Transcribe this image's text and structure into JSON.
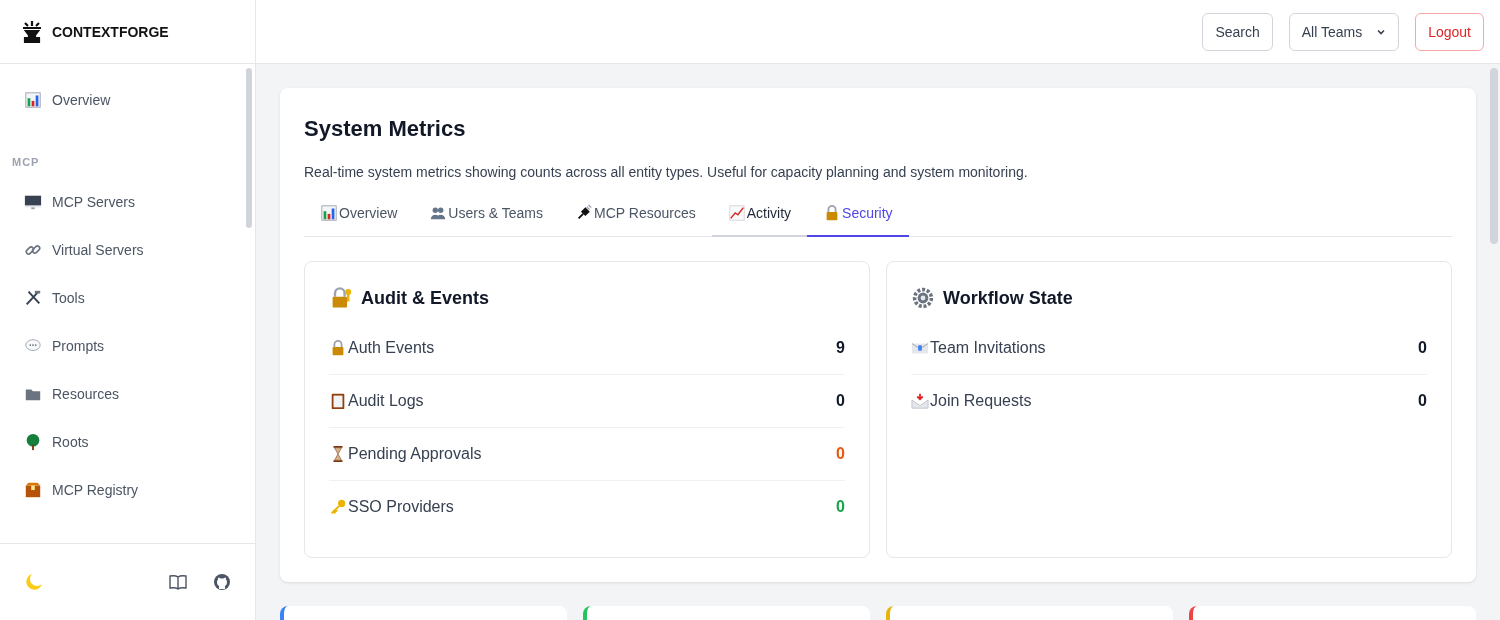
{
  "brand": {
    "name": "CONTEXTFORGE"
  },
  "sidebar": {
    "top_items": [
      {
        "label": "Overview",
        "selected": false
      }
    ],
    "sections": [
      {
        "heading": "MCP",
        "items": [
          {
            "label": "MCP Servers",
            "selected": false
          },
          {
            "label": "Virtual Servers",
            "selected": false
          },
          {
            "label": "Tools",
            "selected": false
          },
          {
            "label": "Prompts",
            "selected": false
          },
          {
            "label": "Resources",
            "selected": false
          },
          {
            "label": "Roots",
            "selected": false
          },
          {
            "label": "MCP Registry",
            "selected": false
          }
        ]
      }
    ]
  },
  "header": {
    "buttons": [
      {
        "label": "Search",
        "kind": "plain"
      },
      {
        "label": "All Teams",
        "kind": "dropdown"
      },
      {
        "label": "Logout",
        "kind": "danger"
      }
    ]
  },
  "panel": {
    "title": "System Metrics",
    "description": "Real-time system metrics showing counts across all entity types. Useful for capacity planning and system monitoring.",
    "tabs": [
      {
        "label": "Overview",
        "selected": false,
        "hovered": false
      },
      {
        "label": "Users & Teams",
        "selected": false,
        "hovered": false
      },
      {
        "label": "MCP Resources",
        "selected": false,
        "hovered": false
      },
      {
        "label": "Activity",
        "selected": false,
        "hovered": true
      },
      {
        "label": "Security",
        "selected": true,
        "hovered": false
      }
    ],
    "cards": [
      {
        "title": "Audit & Events",
        "metrics": [
          {
            "label": "Auth Events",
            "value": "9",
            "color": "#111827"
          },
          {
            "label": "Audit Logs",
            "value": "0",
            "color": "#111827"
          },
          {
            "label": "Pending Approvals",
            "value": "0",
            "color": "#ea580c"
          },
          {
            "label": "SSO Providers",
            "value": "0",
            "color": "#16a34a"
          }
        ]
      },
      {
        "title": "Workflow State",
        "metrics": [
          {
            "label": "Team Invitations",
            "value": "0",
            "color": "#111827"
          },
          {
            "label": "Join Requests",
            "value": "0",
            "color": "#111827"
          }
        ]
      }
    ]
  },
  "summary_cards": [
    {
      "color": "#3b82f6"
    },
    {
      "color": "#22c55e"
    },
    {
      "color": "#eab308"
    },
    {
      "color": "#ef4444"
    }
  ]
}
